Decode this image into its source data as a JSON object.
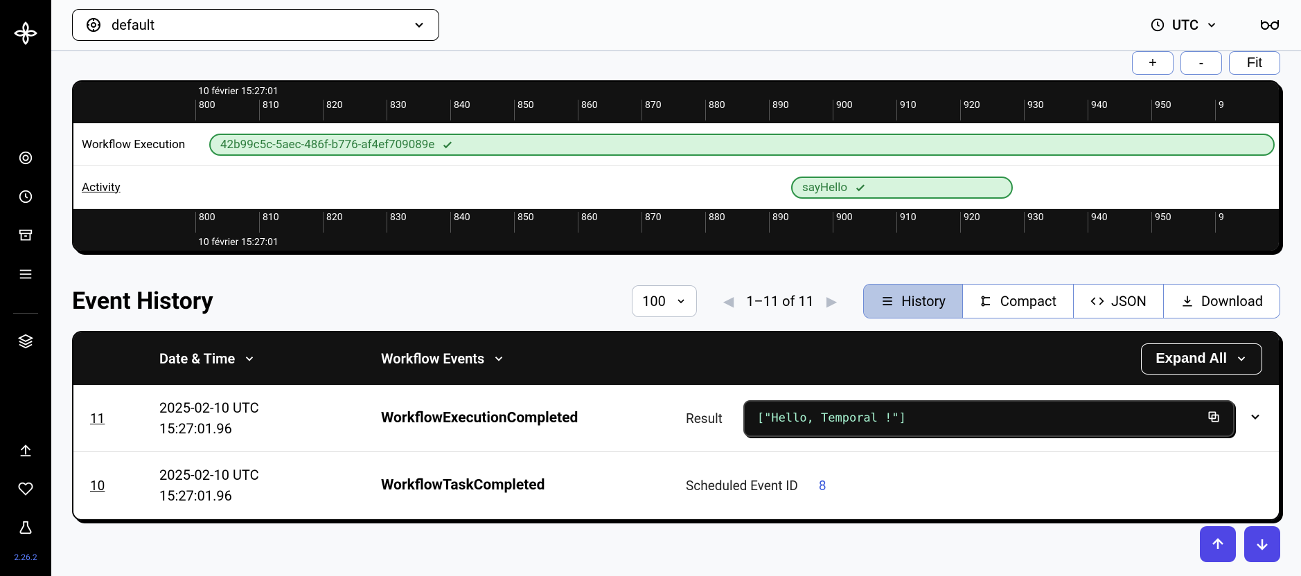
{
  "sidebar": {
    "version": "2.26.2"
  },
  "header": {
    "namespace": "default",
    "tz": "UTC"
  },
  "zoom": {
    "in": "+",
    "out": "-",
    "fit": "Fit"
  },
  "timeline": {
    "topDate": "10 février 15:27:01",
    "bottomDate": "10 février 15:27:01",
    "ticks": [
      "800",
      "810",
      "820",
      "830",
      "840",
      "850",
      "860",
      "870",
      "880",
      "890",
      "900",
      "910",
      "920",
      "930",
      "940",
      "950",
      "9"
    ],
    "rows": {
      "workflowLabel": "Workflow Execution",
      "activityLabel": "Activity",
      "workflowPill": "42b99c5c-5aec-486f-b776-af4ef709089e",
      "activityPill": "sayHello"
    }
  },
  "events": {
    "title": "Event History",
    "pageSize": "100",
    "rangeText": "1–11 of 11",
    "tabs": {
      "history": "History",
      "compact": "Compact",
      "json": "JSON",
      "download": "Download"
    },
    "colDate": "Date & Time",
    "colEvent": "Workflow Events",
    "expandAll": "Expand All",
    "rows": [
      {
        "id": "11",
        "ts_line1": "2025-02-10 UTC",
        "ts_line2": "15:27:01.96",
        "name": "WorkflowExecutionCompleted",
        "metaLabel": "Result",
        "result": "[\"Hello, Temporal !\"]"
      },
      {
        "id": "10",
        "ts_line1": "2025-02-10 UTC",
        "ts_line2": "15:27:01.96",
        "name": "WorkflowTaskCompleted",
        "metaLabel": "Scheduled Event ID",
        "metaValue": "8"
      }
    ]
  }
}
